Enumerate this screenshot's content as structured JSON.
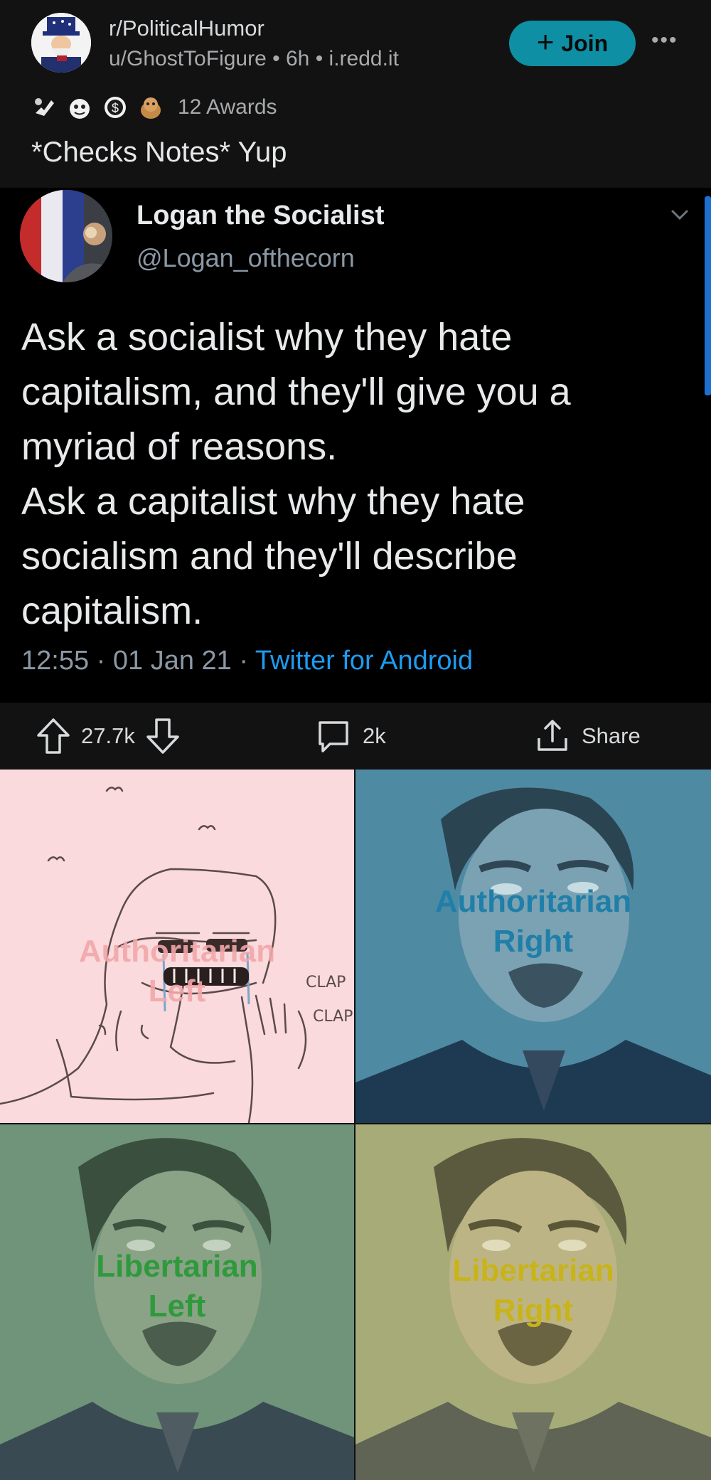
{
  "post": {
    "subreddit": "r/PoliticalHumor",
    "author": "u/GhostToFigure",
    "age": "6h",
    "domain": "i.redd.it",
    "join_label": "Join",
    "awards_label": "12 Awards",
    "title": "*Checks Notes* Yup"
  },
  "tweet": {
    "name": "Logan the Socialist",
    "handle": "@Logan_ofthecorn",
    "lines": [
      "Ask a socialist why they hate",
      "capitalism, and they'll give you a",
      "myriad of reasons.",
      "Ask a capitalist why they hate",
      "socialism and they'll describe",
      "capitalism."
    ],
    "time": "12:55",
    "date": "01 Jan 21",
    "source": "Twitter for Android"
  },
  "actions": {
    "upvotes": "27.7k",
    "comments": "2k",
    "share_label": "Share"
  },
  "meme": {
    "auth_left": [
      "Authoritarian",
      "Left"
    ],
    "auth_right": [
      "Authoritarian",
      "Right"
    ],
    "lib_left": [
      "Libertarian",
      "Left"
    ],
    "lib_right": [
      "Libertarian",
      "Right"
    ],
    "clap1": "CLAP",
    "clap2": "CLAP"
  },
  "colors": {
    "join": "#0e8fa3",
    "link": "#1d9bf0",
    "auth_left_bg": "#fadadd",
    "auth_right_bg": "#4f8aa3",
    "lib_left_bg": "#6f9479",
    "lib_right_bg": "#a7ab78"
  },
  "icons": [
    "uncle-sam-avatar",
    "plus-icon",
    "more-icon",
    "award-icons",
    "chevron-down-icon",
    "upvote-icon",
    "downvote-icon",
    "comment-icon",
    "share-icon"
  ]
}
